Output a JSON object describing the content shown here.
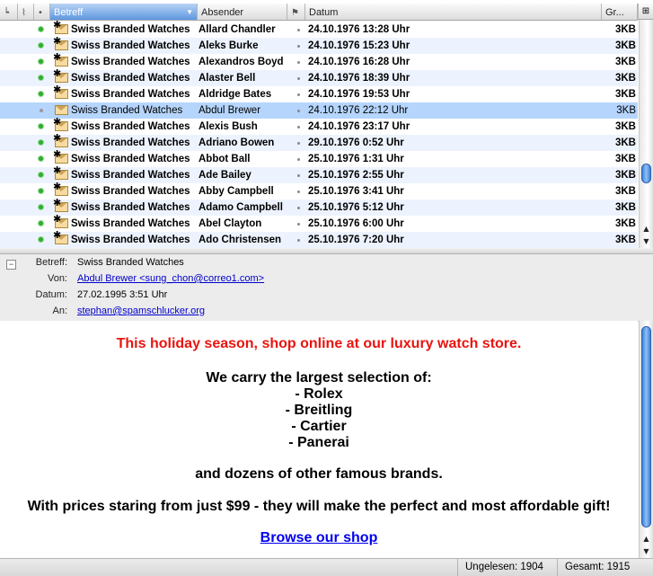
{
  "columns": {
    "subject": "Betreff",
    "from": "Absender",
    "date": "Datum",
    "size": "Gr..."
  },
  "messages": [
    {
      "subject": "Swiss Branded Watches",
      "from": "Allard Chandler",
      "date": "24.10.1976 13:28 Uhr",
      "size": "3KB",
      "state": "unread"
    },
    {
      "subject": "Swiss Branded Watches",
      "from": "Aleks Burke",
      "date": "24.10.1976 15:23 Uhr",
      "size": "3KB",
      "state": "unread"
    },
    {
      "subject": "Swiss Branded Watches",
      "from": "Alexandros Boyd",
      "date": "24.10.1976 16:28 Uhr",
      "size": "3KB",
      "state": "unread"
    },
    {
      "subject": "Swiss Branded Watches",
      "from": "Alaster Bell",
      "date": "24.10.1976 18:39 Uhr",
      "size": "3KB",
      "state": "unread"
    },
    {
      "subject": "Swiss Branded Watches",
      "from": "Aldridge Bates",
      "date": "24.10.1976 19:53 Uhr",
      "size": "3KB",
      "state": "unread"
    },
    {
      "subject": "Swiss Branded Watches",
      "from": "Abdul Brewer",
      "date": "24.10.1976 22:12 Uhr",
      "size": "3KB",
      "state": "selected"
    },
    {
      "subject": "Swiss Branded Watches",
      "from": "Alexis Bush",
      "date": "24.10.1976 23:17 Uhr",
      "size": "3KB",
      "state": "unread"
    },
    {
      "subject": "Swiss Branded Watches",
      "from": "Adriano Bowen",
      "date": "29.10.1976 0:52 Uhr",
      "size": "3KB",
      "state": "unread"
    },
    {
      "subject": "Swiss Branded Watches",
      "from": "Abbot Ball",
      "date": "25.10.1976 1:31 Uhr",
      "size": "3KB",
      "state": "unread"
    },
    {
      "subject": "Swiss Branded Watches",
      "from": "Ade Bailey",
      "date": "25.10.1976 2:55 Uhr",
      "size": "3KB",
      "state": "unread"
    },
    {
      "subject": "Swiss Branded Watches",
      "from": "Abby Campbell",
      "date": "25.10.1976 3:41 Uhr",
      "size": "3KB",
      "state": "unread"
    },
    {
      "subject": "Swiss Branded Watches",
      "from": "Adamo Campbell",
      "date": "25.10.1976 5:12 Uhr",
      "size": "3KB",
      "state": "unread"
    },
    {
      "subject": "Swiss Branded Watches",
      "from": "Abel Clayton",
      "date": "25.10.1976 6:00 Uhr",
      "size": "3KB",
      "state": "unread"
    },
    {
      "subject": "Swiss Branded Watches",
      "from": "Ado Christensen",
      "date": "25.10.1976 7:20 Uhr",
      "size": "3KB",
      "state": "unread"
    }
  ],
  "header": {
    "subject_label": "Betreff:",
    "subject": "Swiss Branded Watches",
    "from_label": "Von:",
    "from": "Abdul Brewer <sung_chon@correo1.com>",
    "date_label": "Datum:",
    "date": "27.02.1995 3:51 Uhr",
    "to_label": "An:",
    "to": "stephan@spamschlucker.org"
  },
  "body": {
    "line1": "This holiday season, shop online at our luxury watch store.",
    "line2": "We carry the largest selection of:",
    "line3": "- Rolex",
    "line4": "- Breitling",
    "line5": "- Cartier",
    "line6": "- Panerai",
    "line7": "and dozens of other famous brands.",
    "line8": "With prices staring from just $99 - they will make the perfect and most affordable gift!",
    "link": "Browse our shop"
  },
  "status": {
    "unread": "Ungelesen: 1904",
    "total": "Gesamt: 1915"
  },
  "colors": {
    "accent": "#5d97e0",
    "selection": "#b5d5fc",
    "body_red": "#e8140f",
    "link": "#0000ee"
  }
}
